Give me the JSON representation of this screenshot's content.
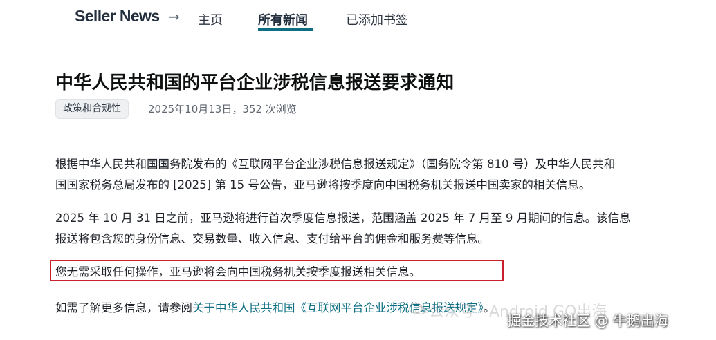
{
  "nav": {
    "brand": "Seller News",
    "arrow": "→",
    "home": "主页",
    "all_news": "所有新闻",
    "bookmarks": "已添加书签"
  },
  "article": {
    "title": "中华人民共和国的平台企业涉税信息报送要求通知",
    "tag": "政策和合规性",
    "meta": "2025年10月13日，352 次浏览",
    "p1_line1": "根据中华人民共和国国务院发布的《互联网平台企业涉税信息报送规定》（国务院令第 810 号）及中华人民共和",
    "p1_line2": "国国家税务总局发布的 [2025] 第 15 号公告，亚马逊将按季度向中国税务机关报送中国卖家的相关信息。",
    "p2_line1": "2025 年 10 月 31 日之前，亚马逊将进行首次季度信息报送，范围涵盖 2025 年 7 月至 9 月期间的信息。该信息",
    "p2_line2": "报送将包含您的身份信息、交易数量、收入信息、支付给平台的佣金和服务费等信息。",
    "highlight": "您无需采取任何操作，亚马逊将会向中国税务机关按季度报送相关信息。",
    "p4_prefix": "如需了解更多信息，请参阅",
    "p4_link": "关于中华人民共和国《互联网平台企业涉税信息报送规定》",
    "p4_suffix": "。"
  },
  "overlay": {
    "watermark": "公众号 · Android GO出海",
    "credit": "掘金技术社区 @ 牛鹅出海"
  },
  "colors": {
    "accent": "#0e6f83",
    "highlight_border": "#c8212d"
  }
}
